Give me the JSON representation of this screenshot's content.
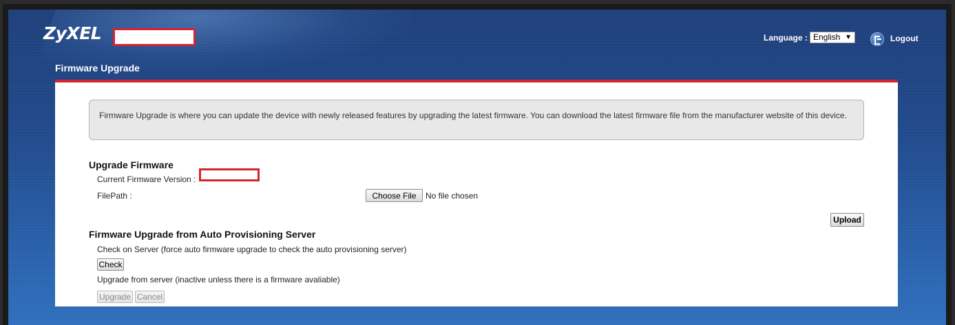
{
  "header": {
    "logo_text": "ZyXEL",
    "language_label": "Language :",
    "language_selected": "English",
    "logout_label": "Logout"
  },
  "page": {
    "title": "Firmware Upgrade",
    "info_text": "Firmware Upgrade is where you can update the device with newly released features by upgrading the latest firmware. You can download the latest firmware file from the manufacturer website of this device."
  },
  "upgrade_firmware": {
    "section_title": "Upgrade Firmware",
    "current_version_label": "Current Firmware Version :",
    "filepath_label": "FilePath :",
    "choose_file_label": "Choose File",
    "no_file_text": "No file chosen",
    "upload_label": "Upload"
  },
  "auto_provisioning": {
    "section_title": "Firmware Upgrade from Auto Provisioning Server",
    "check_description": "Check on Server (force auto firmware upgrade to check the auto provisioning server)",
    "check_label": "Check",
    "upgrade_description": "Upgrade from server (inactive unless there is a firmware avaliable)",
    "upgrade_label": "Upgrade",
    "cancel_label": "Cancel"
  },
  "colors": {
    "accent_red": "#d7232e",
    "header_blue": "#214a8c",
    "panel_bg": "#ffffff"
  }
}
